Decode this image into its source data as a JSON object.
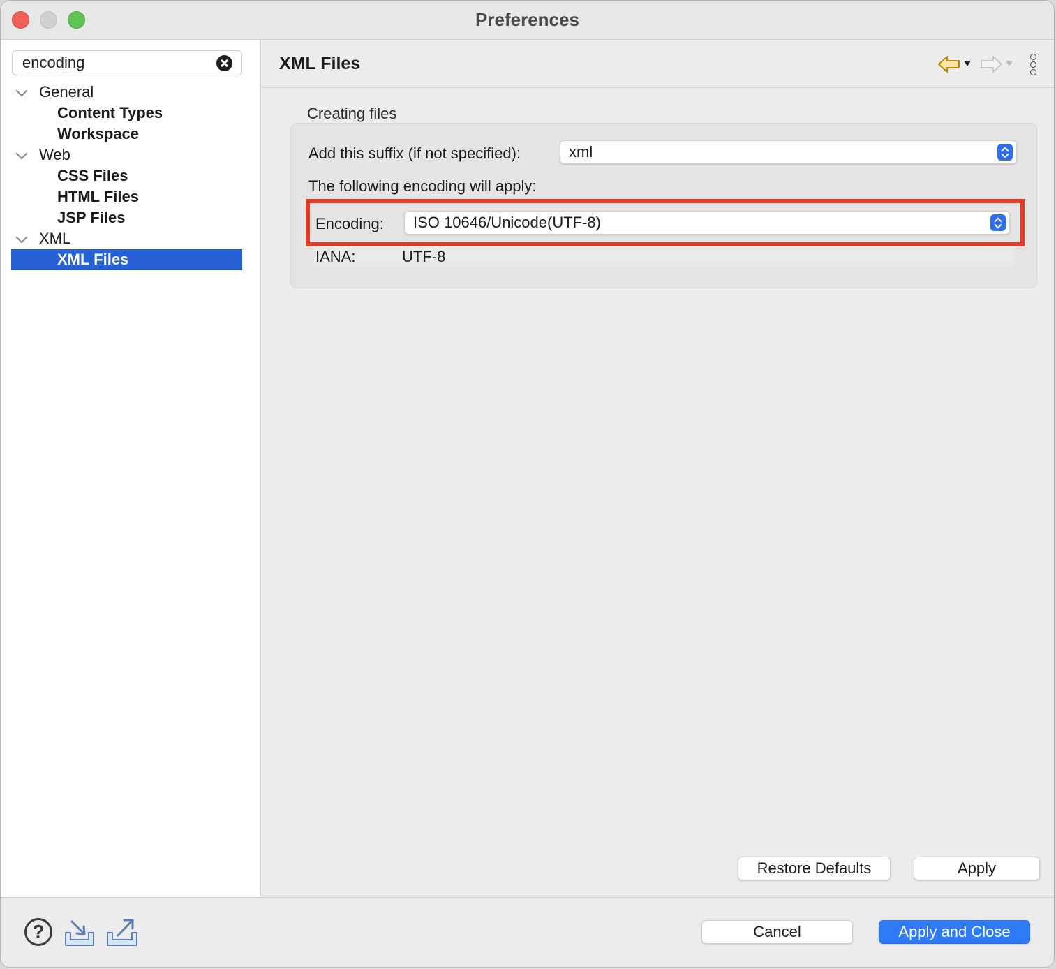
{
  "window": {
    "title": "Preferences"
  },
  "sidebar": {
    "filter_value": "encoding",
    "tree": [
      {
        "label": "General",
        "level": 0,
        "expanded": true
      },
      {
        "label": "Content Types",
        "level": 1
      },
      {
        "label": "Workspace",
        "level": 1
      },
      {
        "label": "Web",
        "level": 0,
        "expanded": true
      },
      {
        "label": "CSS Files",
        "level": 1
      },
      {
        "label": "HTML Files",
        "level": 1
      },
      {
        "label": "JSP Files",
        "level": 1
      },
      {
        "label": "XML",
        "level": 0,
        "expanded": true
      },
      {
        "label": "XML Files",
        "level": 1,
        "selected": true
      }
    ]
  },
  "page": {
    "title": "XML Files",
    "group_title": "Creating files",
    "suffix_label": "Add this suffix (if not specified):",
    "suffix_value": "xml",
    "following_label": "The following encoding will apply:",
    "encoding_label": "Encoding:",
    "encoding_value": "ISO 10646/Unicode(UTF-8)",
    "iana_label": "IANA:",
    "iana_value": "UTF-8",
    "restore_defaults": "Restore Defaults",
    "apply": "Apply"
  },
  "footer": {
    "help_glyph": "?",
    "cancel": "Cancel",
    "apply_and_close": "Apply and Close"
  },
  "colors": {
    "selection": "#2660d6",
    "highlight_box": "#e23b26",
    "primary_button": "#2f7bf6",
    "nav_back_arrow": "#e0a800"
  }
}
